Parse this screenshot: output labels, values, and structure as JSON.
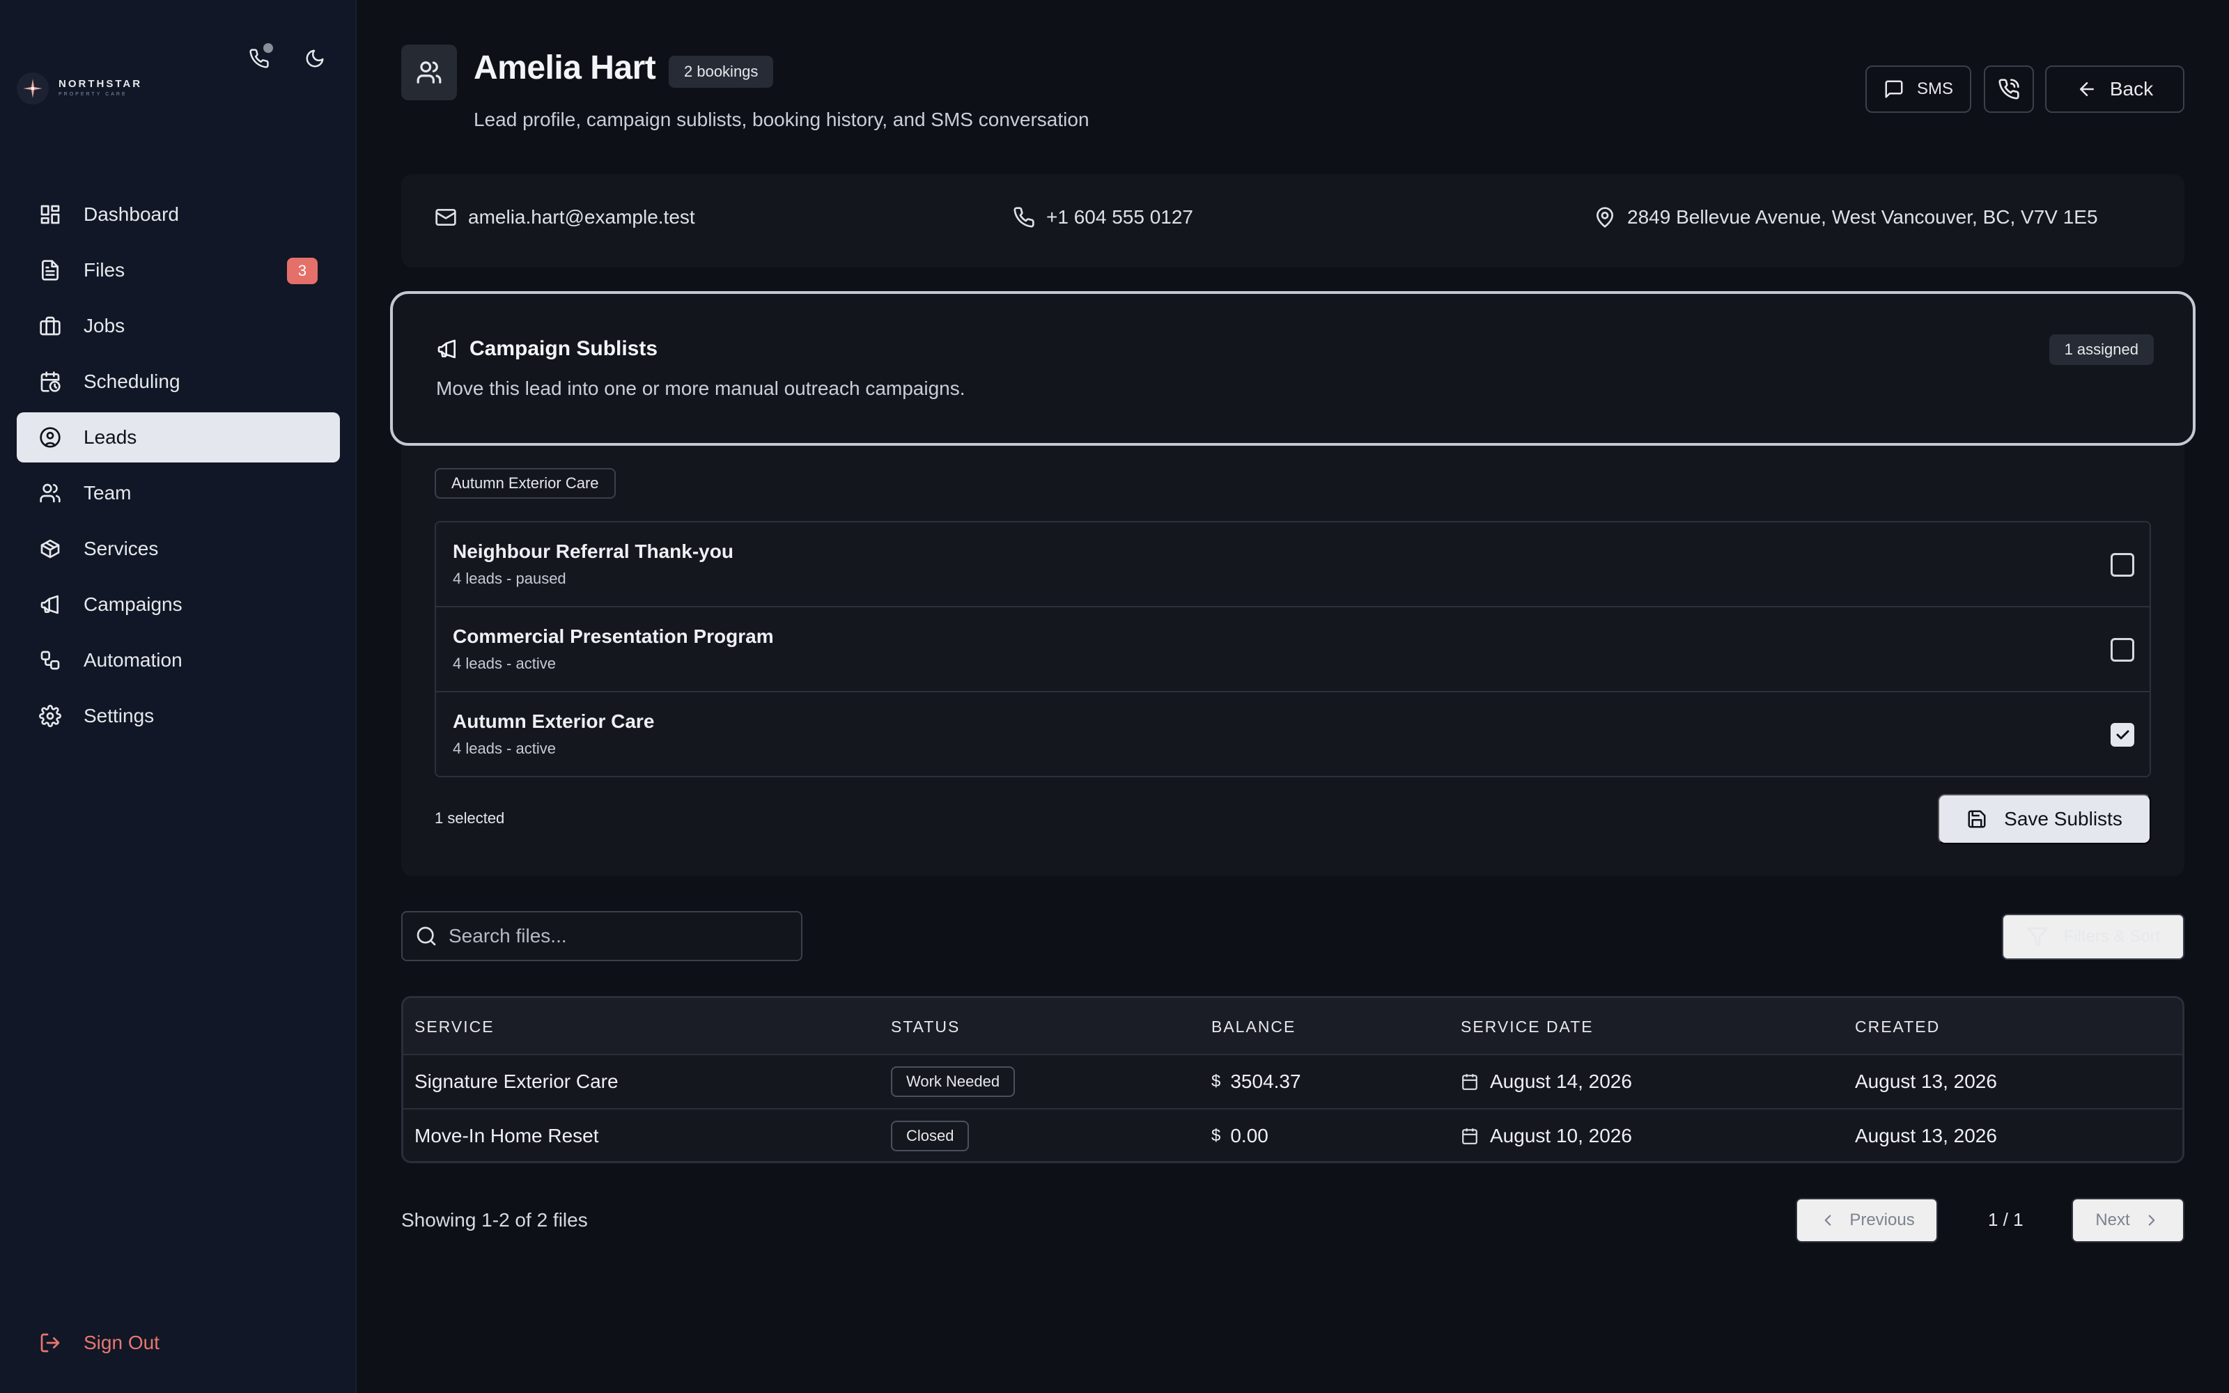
{
  "app": {
    "logo_line1": "NORTHSTAR",
    "logo_line2": "PROPERTY CARE"
  },
  "sidebar": {
    "items": [
      {
        "label": "Dashboard",
        "icon": "dashboard-icon"
      },
      {
        "label": "Files",
        "icon": "file-icon",
        "badge": "3"
      },
      {
        "label": "Jobs",
        "icon": "briefcase-icon"
      },
      {
        "label": "Scheduling",
        "icon": "calendar-clock-icon"
      },
      {
        "label": "Leads",
        "icon": "user-circle-icon",
        "active": true
      },
      {
        "label": "Team",
        "icon": "users-icon"
      },
      {
        "label": "Services",
        "icon": "package-icon"
      },
      {
        "label": "Campaigns",
        "icon": "megaphone-icon"
      },
      {
        "label": "Automation",
        "icon": "workflow-icon"
      },
      {
        "label": "Settings",
        "icon": "gear-icon"
      }
    ],
    "sign_out": "Sign Out"
  },
  "header": {
    "title": "Amelia Hart",
    "bookings_badge": "2 bookings",
    "subtitle": "Lead profile, campaign sublists, booking history, and SMS conversation",
    "sms_label": "SMS",
    "back_label": "Back"
  },
  "contact": {
    "email": "amelia.hart@example.test",
    "phone": "+1 604 555 0127",
    "address": "2849 Bellevue Avenue, West Vancouver, BC, V7V 1E5"
  },
  "campaign": {
    "title": "Campaign Sublists",
    "description": "Move this lead into one or more manual outreach campaigns.",
    "assigned_badge": "1 assigned",
    "assigned_tag": "Autumn Exterior Care",
    "sublists": [
      {
        "name": "Neighbour Referral Thank-you",
        "meta": "4 leads - paused",
        "checked": false
      },
      {
        "name": "Commercial Presentation Program",
        "meta": "4 leads - active",
        "checked": false
      },
      {
        "name": "Autumn Exterior Care",
        "meta": "4 leads - active",
        "checked": true
      }
    ],
    "selected_count": "1 selected",
    "save_label": "Save Sublists"
  },
  "files": {
    "search_placeholder": "Search files...",
    "filter_label": "Filters & Sort",
    "columns": [
      "SERVICE",
      "STATUS",
      "BALANCE",
      "SERVICE DATE",
      "CREATED"
    ],
    "currency": "$",
    "rows": [
      {
        "service": "Signature Exterior Care",
        "status": "Work Needed",
        "balance": "3504.37",
        "service_date": "August 14, 2026",
        "created": "August 13, 2026"
      },
      {
        "service": "Move-In Home Reset",
        "status": "Closed",
        "balance": "0.00",
        "service_date": "August 10, 2026",
        "created": "August 13, 2026"
      }
    ],
    "showing": "Showing 1-2 of 2 files",
    "prev_label": "Previous",
    "next_label": "Next",
    "page_indicator": "1 / 1"
  }
}
